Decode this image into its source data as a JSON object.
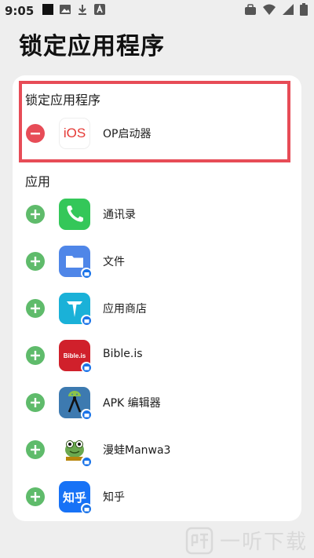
{
  "status_bar": {
    "time": "9:05",
    "left_icons": [
      "notification-square-icon",
      "image-icon",
      "download-icon",
      "font-app-icon"
    ],
    "right_icons": [
      "briefcase-icon",
      "wifi-icon",
      "signal-icon",
      "battery-icon"
    ]
  },
  "page": {
    "title": "锁定应用程序"
  },
  "locked_section": {
    "label": "锁定应用程序",
    "items": [
      {
        "name": "OP启动器",
        "icon_text": "iOS",
        "action": "remove"
      }
    ]
  },
  "apps_section": {
    "label": "应用",
    "items": [
      {
        "name": "通讯录",
        "icon": "phone-icon",
        "action": "add"
      },
      {
        "name": "文件",
        "icon": "folder-icon",
        "action": "add"
      },
      {
        "name": "应用商店",
        "icon": "store-icon",
        "action": "add"
      },
      {
        "name": "Bible.is",
        "icon_text": "Bible.is",
        "action": "add"
      },
      {
        "name": "APK 编辑器",
        "icon": "apk-editor-icon",
        "action": "add"
      },
      {
        "name": "漫蛙Manwa3",
        "icon": "frog-icon",
        "action": "add"
      },
      {
        "name": "知乎",
        "icon_text": "知乎",
        "action": "add"
      }
    ]
  },
  "watermark": {
    "text": "一听下载"
  },
  "colors": {
    "remove_red": "#e74c57",
    "add_green": "#5fbb6b",
    "highlight_border": "#e74c57"
  }
}
